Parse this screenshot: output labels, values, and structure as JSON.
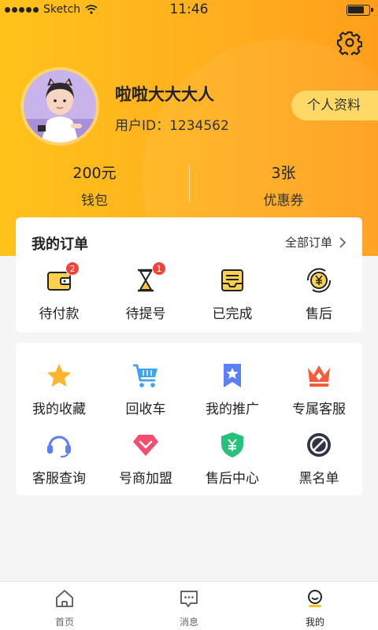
{
  "status_bar": {
    "carrier": "Sketch",
    "time": "11:46"
  },
  "profile": {
    "name": "啦啦大大大人",
    "user_id": "用户ID：1234562",
    "profile_button": "个人资料"
  },
  "stats": [
    {
      "value": "200元",
      "label": "钱包"
    },
    {
      "value": "3张",
      "label": "优惠券"
    }
  ],
  "orders": {
    "title": "我的订单",
    "all_label": "全部订单",
    "items": [
      {
        "label": "待付款",
        "badge": "2",
        "icon": "wallet-icon"
      },
      {
        "label": "待提号",
        "badge": "1",
        "icon": "hourglass-icon"
      },
      {
        "label": "已完成",
        "icon": "inbox-icon"
      },
      {
        "label": "售后",
        "icon": "yen-refresh-icon"
      }
    ]
  },
  "services": [
    {
      "label": "我的收藏",
      "icon": "star-icon"
    },
    {
      "label": "回收车",
      "icon": "cart-icon"
    },
    {
      "label": "我的推广",
      "icon": "bookmark-icon"
    },
    {
      "label": "专属客服",
      "icon": "crown-icon"
    },
    {
      "label": "客服查询",
      "icon": "headset-icon"
    },
    {
      "label": "号商加盟",
      "icon": "diamond-icon"
    },
    {
      "label": "售后中心",
      "icon": "shield-yen-icon"
    },
    {
      "label": "黑名单",
      "icon": "block-icon"
    }
  ],
  "tabbar": [
    {
      "label": "首页",
      "icon": "home-icon"
    },
    {
      "label": "消息",
      "icon": "message-icon"
    },
    {
      "label": "我的",
      "icon": "profile-icon",
      "active": true
    }
  ],
  "colors": {
    "accent": "#ffb21f",
    "badge": "#f44336",
    "profile_button_bg": "#ffd966"
  }
}
